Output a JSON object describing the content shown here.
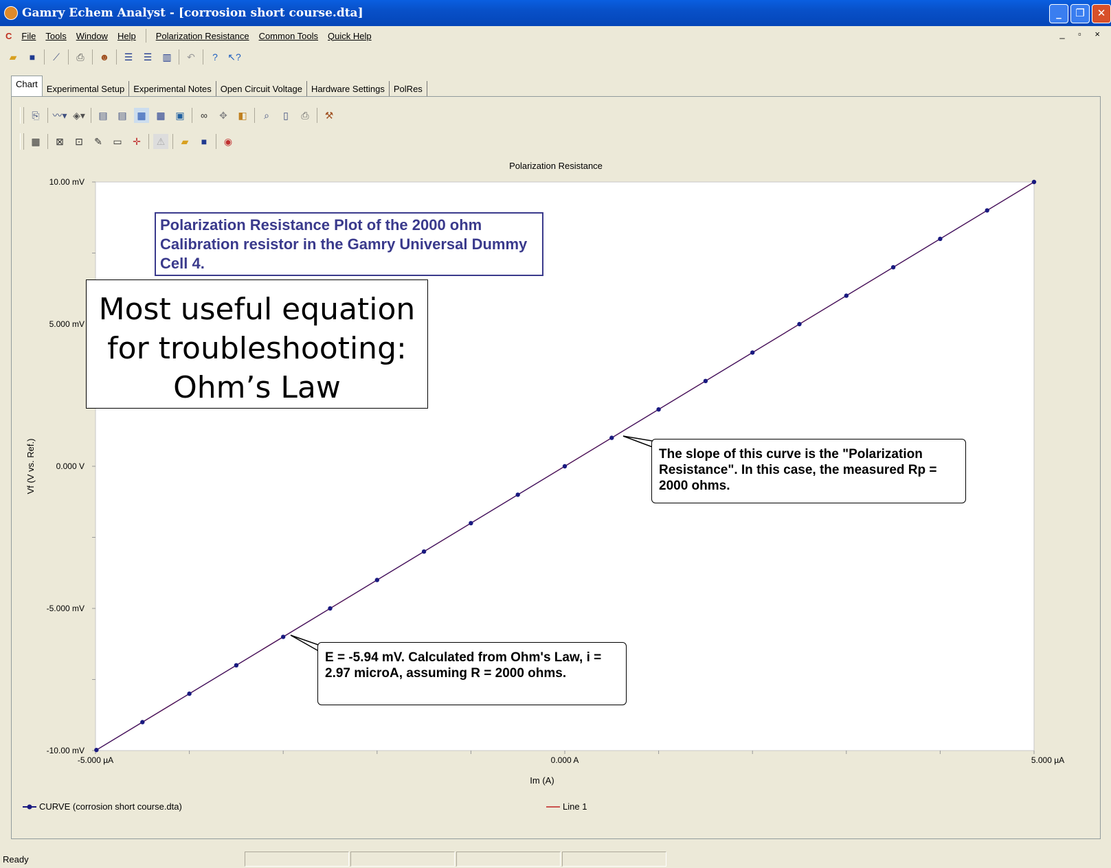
{
  "window": {
    "title": "Gamry Echem Analyst - [corrosion short course.dta]"
  },
  "menubar": {
    "items": [
      "File",
      "Tools",
      "Window",
      "Help",
      "Polarization Resistance",
      "Common Tools",
      "Quick Help"
    ],
    "mdi_controls": "_ &#x1F5D7; ×"
  },
  "tabs": [
    "Chart",
    "Experimental Setup",
    "Experimental Notes",
    "Open Circuit Voltage",
    "Hardware Settings",
    "PolRes"
  ],
  "chart_data": {
    "type": "line",
    "title": "Polarization Resistance",
    "xlabel": "Im (A)",
    "ylabel": "Vf (V vs. Ref.)",
    "xlim": [
      -5.0,
      5.0
    ],
    "ylim": [
      -10.0,
      10.0
    ],
    "x_unit": "µA",
    "y_unit": "mV",
    "x_ticks": [
      "-5.000 µA",
      "0.000 A",
      "5.000 µA"
    ],
    "y_ticks": [
      "10.00 mV",
      "5.000 mV",
      "0.000 V",
      "-5.000 mV",
      "-10.00 mV"
    ],
    "series": [
      {
        "name": "CURVE (corrosion short course.dta)",
        "color": "#1a1a80",
        "x": [
          -4.99,
          -4.5,
          -4.0,
          -3.5,
          -3.0,
          -2.5,
          -2.0,
          -1.5,
          -1.0,
          -0.5,
          0.0,
          0.5,
          1.0,
          1.5,
          2.0,
          2.5,
          3.0,
          3.5,
          4.0,
          4.5,
          5.0
        ],
        "y": [
          -9.98,
          -9.0,
          -8.0,
          -7.0,
          -6.0,
          -5.0,
          -4.0,
          -3.0,
          -2.0,
          -1.0,
          0.0,
          1.0,
          2.0,
          3.0,
          4.0,
          5.0,
          6.0,
          7.0,
          8.0,
          9.0,
          10.0
        ]
      },
      {
        "name": "Line 1",
        "color": "#c02020",
        "x": [
          -5.0,
          5.0
        ],
        "y": [
          -10.0,
          10.0
        ]
      }
    ],
    "grid": false
  },
  "annotations": {
    "plot_title_box": "Polarization Resistance Plot of the 2000 ohm Calibration resistor in the Gamry Universal Dummy Cell 4.",
    "big_box_lines": [
      "Most useful equation",
      "for troubleshooting:",
      "Ohm’s Law"
    ],
    "slope_callout": "The slope of this curve is the \"Polarization Resistance\".  In this case, the measured Rp = 2000 ohms.",
    "point_callout": "E = -5.94 mV.  Calculated from Ohm's Law, i = 2.97 microA, assuming R = 2000 ohms."
  },
  "legend": {
    "series1": "CURVE (corrosion short course.dta)",
    "series2": "Line 1"
  },
  "statusbar": {
    "text": "Ready"
  }
}
